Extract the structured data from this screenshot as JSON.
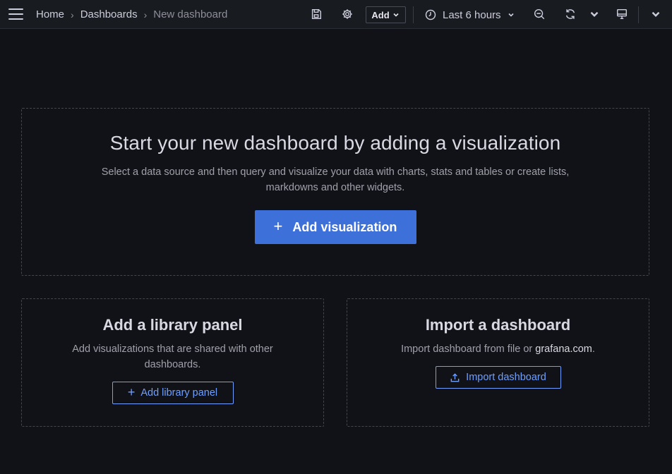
{
  "breadcrumb": {
    "items": [
      "Home",
      "Dashboards",
      "New dashboard"
    ],
    "separator": "›"
  },
  "toolbar": {
    "add_label": "Add",
    "time_range": "Last 6 hours",
    "icons": [
      "save-icon",
      "gear-icon",
      "clock-icon",
      "zoom-out-icon",
      "refresh-icon",
      "monitor-icon",
      "chevron-down-icon"
    ]
  },
  "empty_state": {
    "title": "Start your new dashboard by adding a visualization",
    "description": "Select a data source and then query and visualize your data with charts, stats and tables or create lists, markdowns and other widgets.",
    "button_label": "Add visualization",
    "button_icon": "+"
  },
  "library_panel": {
    "title": "Add a library panel",
    "description": "Add visualizations that are shared with other dashboards.",
    "button_label": "Add library panel",
    "button_icon": "+"
  },
  "import_panel": {
    "title": "Import a dashboard",
    "description_prefix": "Import dashboard from file or ",
    "description_link": "grafana.com",
    "description_suffix": ".",
    "button_label": "Import dashboard"
  },
  "colors": {
    "background": "#111217",
    "topbar": "#181b1f",
    "primary": "#3d71d9",
    "link": "#6e9fff"
  }
}
